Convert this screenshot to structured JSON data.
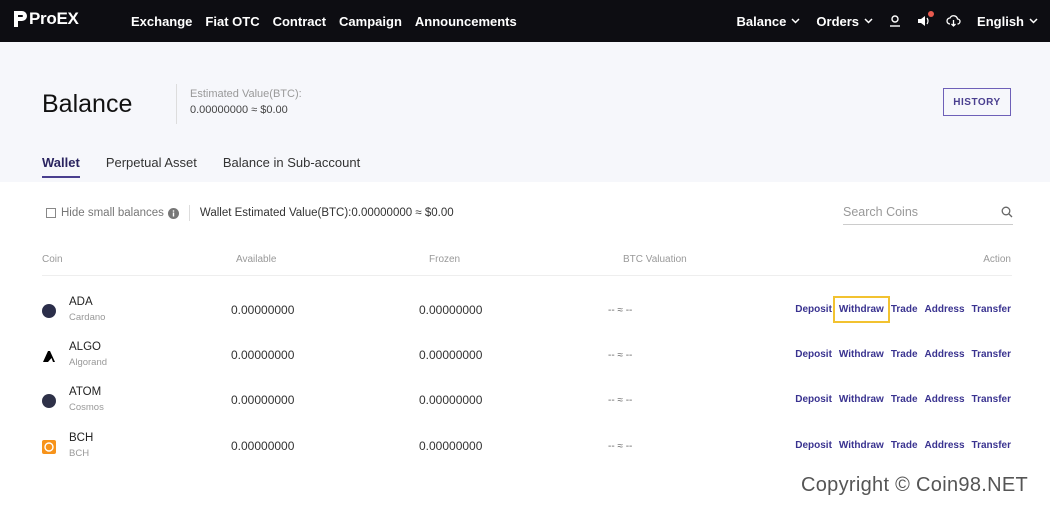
{
  "brand": {
    "name": "ProEX"
  },
  "nav": {
    "left": [
      "Exchange",
      "Fiat OTC",
      "Contract",
      "Campaign",
      "Announcements"
    ],
    "balance": "Balance",
    "orders": "Orders",
    "language": "English"
  },
  "header": {
    "title": "Balance",
    "est_label": "Estimated Value(BTC):",
    "est_value": "0.00000000 ≈ $0.00",
    "history": "HISTORY"
  },
  "tabs": [
    "Wallet",
    "Perpetual Asset",
    "Balance in Sub-account"
  ],
  "filter": {
    "hide_small": "Hide small balances",
    "wallet_est": "Wallet Estimated Value(BTC):0.00000000 ≈ $0.00",
    "search_placeholder": "Search Coins"
  },
  "table": {
    "headers": {
      "coin": "Coin",
      "available": "Available",
      "frozen": "Frozen",
      "btc": "BTC Valuation",
      "action": "Action"
    },
    "actions": [
      "Deposit",
      "Withdraw",
      "Trade",
      "Address",
      "Transfer"
    ],
    "rows": [
      {
        "symbol": "ADA",
        "name": "Cardano",
        "available": "0.00000000",
        "frozen": "0.00000000",
        "btc": "-- ≈ --",
        "icon_color": "#2b2e4a"
      },
      {
        "symbol": "ALGO",
        "name": "Algorand",
        "available": "0.00000000",
        "frozen": "0.00000000",
        "btc": "-- ≈ --",
        "icon_color": "#000000"
      },
      {
        "symbol": "ATOM",
        "name": "Cosmos",
        "available": "0.00000000",
        "frozen": "0.00000000",
        "btc": "-- ≈ --",
        "icon_color": "#2e3148"
      },
      {
        "symbol": "BCH",
        "name": "BCH",
        "available": "0.00000000",
        "frozen": "0.00000000",
        "btc": "-- ≈ --",
        "icon_color": "#f7931a"
      }
    ]
  },
  "copyright": "Copyright © Coin98.NET",
  "colors": {
    "accent": "#4a3f8f",
    "nav_bg": "#0d0d12",
    "highlight": "#f2c230"
  }
}
